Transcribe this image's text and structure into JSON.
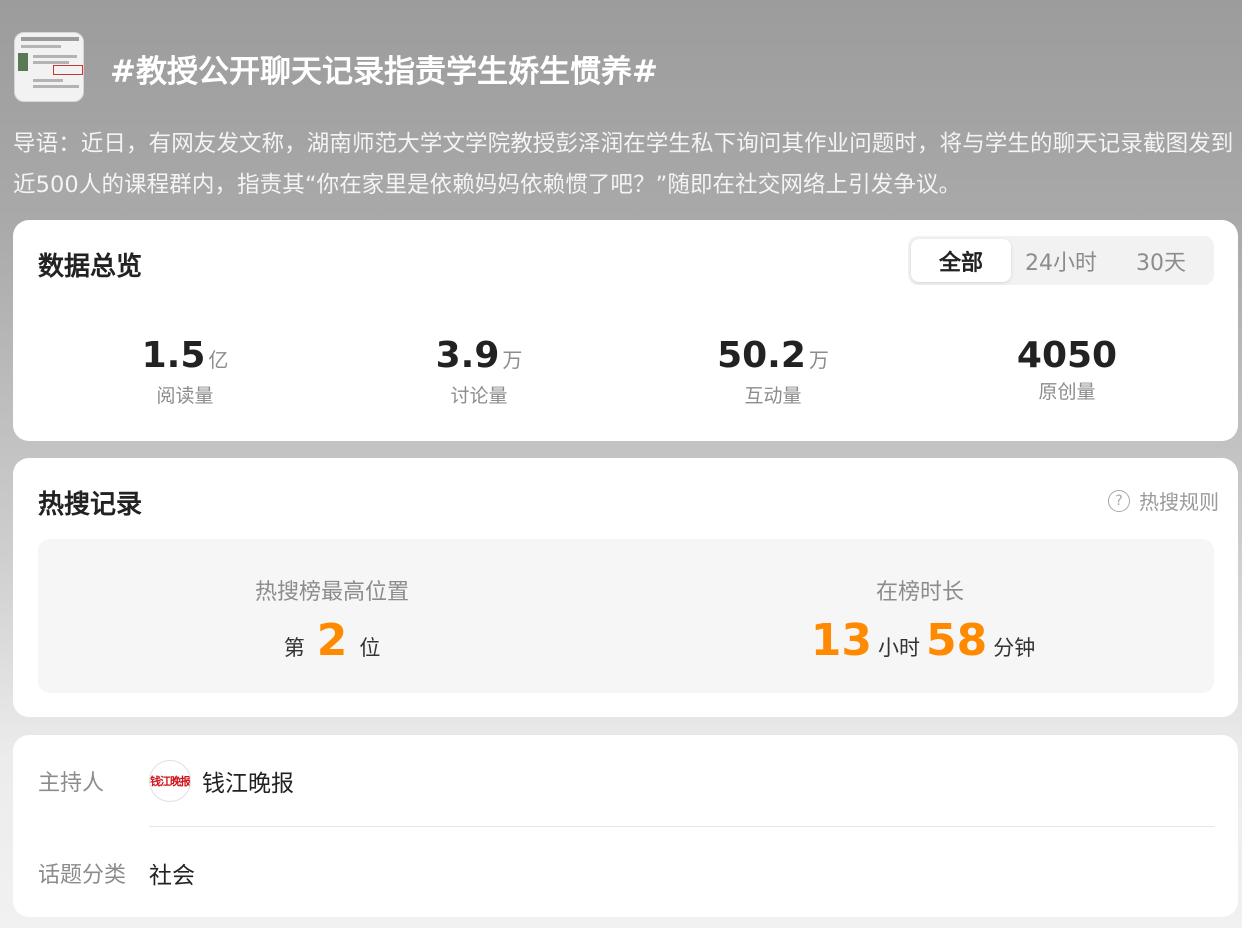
{
  "topic": {
    "title": "#教授公开聊天记录指责学生娇生惯养#",
    "lead": "导语：近日，有网友发文称，湖南师范大学文学院教授彭泽润在学生私下询问其作业问题时，将与学生的聊天记录截图发到近500人的课程群内，指责其“你在家里是依赖妈妈依赖惯了吧？”随即在社交网络上引发争议。"
  },
  "overview": {
    "title": "数据总览",
    "tabs": [
      "全部",
      "24小时",
      "30天"
    ],
    "active_tab": "全部",
    "stats": [
      {
        "value": "1.5",
        "unit": "亿",
        "label": "阅读量"
      },
      {
        "value": "3.9",
        "unit": "万",
        "label": "讨论量"
      },
      {
        "value": "50.2",
        "unit": "万",
        "label": "互动量"
      },
      {
        "value": "4050",
        "unit": "",
        "label": "原创量"
      }
    ]
  },
  "hot": {
    "title": "热搜记录",
    "rules_label": "热搜规则",
    "rules_icon": "question-circle-icon",
    "peak_label": "热搜榜最高位置",
    "peak_prefix": "第",
    "peak_value": "2",
    "peak_suffix": "位",
    "duration_label": "在榜时长",
    "duration_hours": "13",
    "hours_unit": "小时",
    "duration_minutes": "58",
    "minutes_unit": "分钟",
    "accent_color": "#ff8a00"
  },
  "info": {
    "host_key": "主持人",
    "host_name": "钱江晚报",
    "host_logo_text": "钱江晚报",
    "category_key": "话题分类",
    "category_value": "社会"
  }
}
